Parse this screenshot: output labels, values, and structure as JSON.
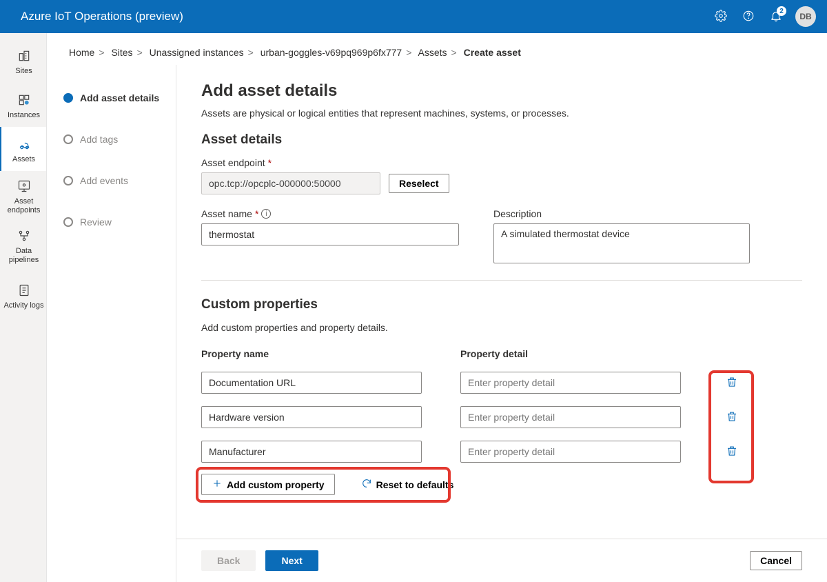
{
  "topbar": {
    "title": "Azure IoT Operations (preview)",
    "notification_count": "2",
    "avatar_initials": "DB"
  },
  "nav": {
    "items": [
      {
        "label": "Sites"
      },
      {
        "label": "Instances"
      },
      {
        "label": "Assets"
      },
      {
        "label": "Asset endpoints"
      },
      {
        "label": "Data pipelines"
      },
      {
        "label": "Activity logs"
      }
    ]
  },
  "breadcrumb": {
    "parts": [
      "Home",
      "Sites",
      "Unassigned instances",
      "urban-goggles-v69pq969p6fx777",
      "Assets"
    ],
    "current": "Create asset"
  },
  "steps": [
    {
      "label": "Add asset details",
      "active": true
    },
    {
      "label": "Add tags"
    },
    {
      "label": "Add events"
    },
    {
      "label": "Review"
    }
  ],
  "page": {
    "title": "Add asset details",
    "subtitle": "Assets are physical or logical entities that represent machines, systems, or processes.",
    "section_asset_details": "Asset details",
    "endpoint_label": "Asset endpoint",
    "endpoint_value": "opc.tcp://opcplc-000000:50000",
    "reselect": "Reselect",
    "asset_name_label": "Asset name",
    "asset_name_value": "thermostat",
    "description_label": "Description",
    "description_value": "A simulated thermostat device",
    "section_custom": "Custom properties",
    "custom_sub": "Add custom properties and property details.",
    "col_name": "Property name",
    "col_detail": "Property detail",
    "detail_placeholder": "Enter property detail",
    "rows": [
      {
        "name": "Documentation URL",
        "detail": ""
      },
      {
        "name": "Hardware version",
        "detail": ""
      },
      {
        "name": "Manufacturer",
        "detail": ""
      }
    ],
    "add_custom": "Add custom property",
    "reset_defaults": "Reset to defaults"
  },
  "footer": {
    "back": "Back",
    "next": "Next",
    "cancel": "Cancel"
  }
}
